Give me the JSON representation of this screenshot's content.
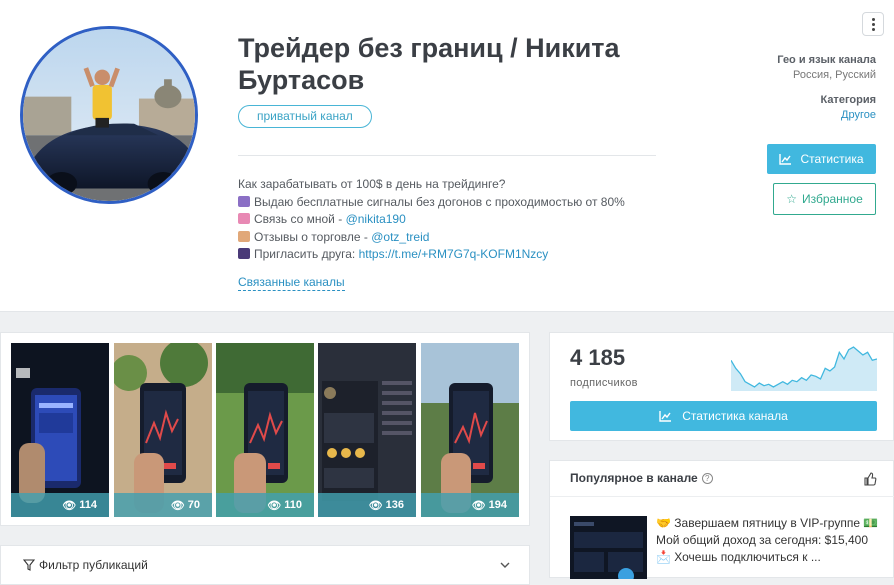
{
  "channel": {
    "title": "Трейдер без границ / Никита Буртасов",
    "badge": "приватный канал",
    "description": [
      {
        "emoji": "",
        "text": "Как зарабатывать от 100$ в день на трейдинге?",
        "link": ""
      },
      {
        "emoji": "person",
        "text": "Выдаю бесплатные сигналы без догонов с проходимостью от 80%",
        "link": ""
      },
      {
        "emoji": "inbox",
        "text": "Связь со мной - ",
        "link": "@nikita190"
      },
      {
        "emoji": "writing",
        "text": "Отзывы о торговле - ",
        "link": "@otz_treid"
      },
      {
        "emoji": "people",
        "text": "Пригласить друга: ",
        "link": "https://t.me/+RM7G7q-KOFM1Nzcy"
      }
    ],
    "related_link": "Связанные каналы"
  },
  "meta": {
    "geo_label": "Гео и язык канала",
    "geo_value": "Россия, Русский",
    "category_label": "Категория",
    "category_value": "Другое"
  },
  "actions": {
    "stats_label": "Статистика",
    "favorites_label": "Избранное",
    "menu_icon": "kebab-menu-icon"
  },
  "gallery": [
    {
      "views": "114",
      "scene": "dark-cafe"
    },
    {
      "views": "70",
      "scene": "plants"
    },
    {
      "views": "110",
      "scene": "lawn"
    },
    {
      "views": "136",
      "scene": "screenshot"
    },
    {
      "views": "194",
      "scene": "outdoor"
    }
  ],
  "subscribers": {
    "count": "4 185",
    "label": "подписчиков",
    "button_label": "Статистика канала",
    "trend": [
      30,
      24,
      20,
      14,
      12,
      10,
      13,
      11,
      12,
      10,
      12,
      14,
      12,
      15,
      14,
      17,
      15,
      19,
      18,
      16,
      24,
      22,
      25,
      36,
      31,
      38,
      40,
      37,
      34,
      36,
      30,
      31
    ]
  },
  "popular": {
    "title": "Популярное в канале",
    "lines": [
      "🤝 Завершаем пятницу в VIP-группе 💵",
      "Мой общий доход за сегодня: $15,400",
      "📩 Хочешь подключиться к ..."
    ]
  },
  "filter": {
    "label": "Фильтр публикаций"
  },
  "colors": {
    "accent": "#41b8df",
    "favorite": "#31a98f",
    "link": "#2a90c2",
    "avatar_ring": "#2f5fc4"
  }
}
